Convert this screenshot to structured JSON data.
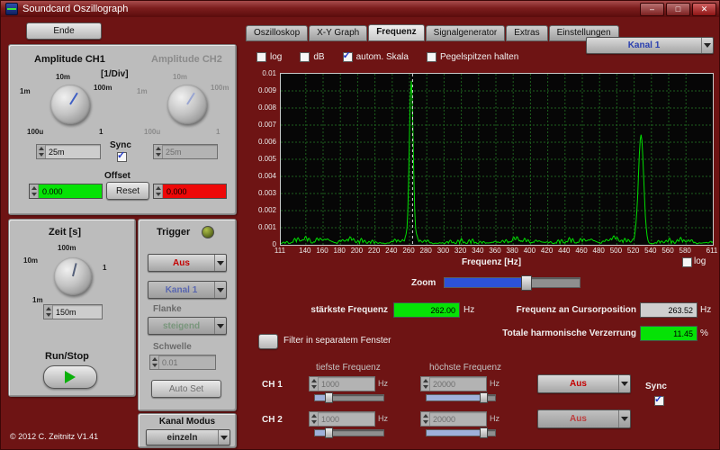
{
  "window": {
    "title": "Soundcard Oszillograph",
    "minimize_glyph": "–",
    "maximize_glyph": "□",
    "close_glyph": "✕"
  },
  "left": {
    "ende_button": "Ende",
    "amplitude": {
      "ch1_label": "Amplitude CH1",
      "div_label": "[1/Div]",
      "ch2_label": "Amplitude CH2",
      "ticks": {
        "t1m": "1m",
        "t10m": "10m",
        "t100m": "100m",
        "t100u": "100u",
        "t1": "1"
      },
      "ch1_value": "25m",
      "ch2_value": "25m",
      "sync_label": "Sync",
      "sync_checked": true,
      "offset_label": "Offset",
      "ch1_offset": "0.000",
      "reset_button": "Reset",
      "ch2_offset": "0.000"
    },
    "zeit": {
      "label": "Zeit [s]",
      "ticks": {
        "t10m": "10m",
        "t100m": "100m",
        "t1": "1",
        "t1m": "1m"
      },
      "value": "150m",
      "runstop_label": "Run/Stop"
    },
    "trigger": {
      "label": "Trigger",
      "mode": "Aus",
      "channel": "Kanal 1",
      "flanke_label": "Flanke",
      "flanke_value": "steigend",
      "schwelle_label": "Schwelle",
      "schwelle_value": "0.01",
      "autoset_button": "Auto Set"
    },
    "kanal_modus": {
      "label": "Kanal Modus",
      "value": "einzeln"
    },
    "copyright": "© 2012  C. Zeitnitz V1.41"
  },
  "tabs": [
    "Oszilloskop",
    "X-Y Graph",
    "Frequenz",
    "Signalgenerator",
    "Extras",
    "Einstellungen"
  ],
  "active_tab": "Frequenz",
  "freq": {
    "channel_select": "Kanal 1",
    "checkboxes": [
      {
        "label": "log",
        "checked": false
      },
      {
        "label": "dB",
        "checked": false
      },
      {
        "label": "autom. Skala",
        "checked": true
      },
      {
        "label": "Pegelspitzen halten",
        "checked": false
      }
    ],
    "xaxis_label": "Frequenz [Hz]",
    "log_label": "log",
    "log_checked": false,
    "zoom_label": "Zoom",
    "zoom_percent": 60,
    "staerkste_label": "stärkste Frequenz",
    "staerkste_value": "262.00",
    "staerkste_unit": "Hz",
    "cursor_label": "Frequenz an Cursorposition",
    "cursor_value": "263.52",
    "cursor_unit": "Hz",
    "thd_label": "Totale harmonische Verzerrung",
    "thd_value": "11.45",
    "thd_unit": "%",
    "filter_label": "Filter in separatem Fenster",
    "filter": {
      "low_header": "tiefste Frequenz",
      "high_header": "höchste Frequenz",
      "ch1_label": "CH 1",
      "ch2_label": "CH 2",
      "ch1_low": "1000",
      "ch1_high": "20000",
      "ch2_low": "1000",
      "ch2_high": "20000",
      "unit": "Hz",
      "ch1_mode": "Aus",
      "ch2_mode": "Aus",
      "sync_label": "Sync",
      "sync_checked": true
    }
  },
  "chart_data": {
    "type": "line",
    "title": "",
    "xlabel": "Frequenz [Hz]",
    "ylabel": "",
    "xlim": [
      111,
      611
    ],
    "ylim": [
      0,
      0.01
    ],
    "x_ticks": [
      111,
      140,
      160,
      180,
      200,
      220,
      240,
      260,
      280,
      300,
      320,
      340,
      360,
      380,
      400,
      420,
      440,
      460,
      480,
      500,
      520,
      540,
      560,
      580,
      611
    ],
    "y_ticks": [
      0,
      0.001,
      0.002,
      0.003,
      0.004,
      0.005,
      0.006,
      0.007,
      0.008,
      0.009,
      0.01
    ],
    "peaks": [
      {
        "freq": 262,
        "amp": 0.0095,
        "sigma": 2.2
      },
      {
        "freq": 528,
        "amp": 0.0063,
        "sigma": 3.0
      }
    ],
    "noise_floor": 0.0002,
    "cursor_freq": 263.52,
    "grid": true,
    "trace_color": "#00dd00",
    "grid_color": "#1d5f1d"
  }
}
